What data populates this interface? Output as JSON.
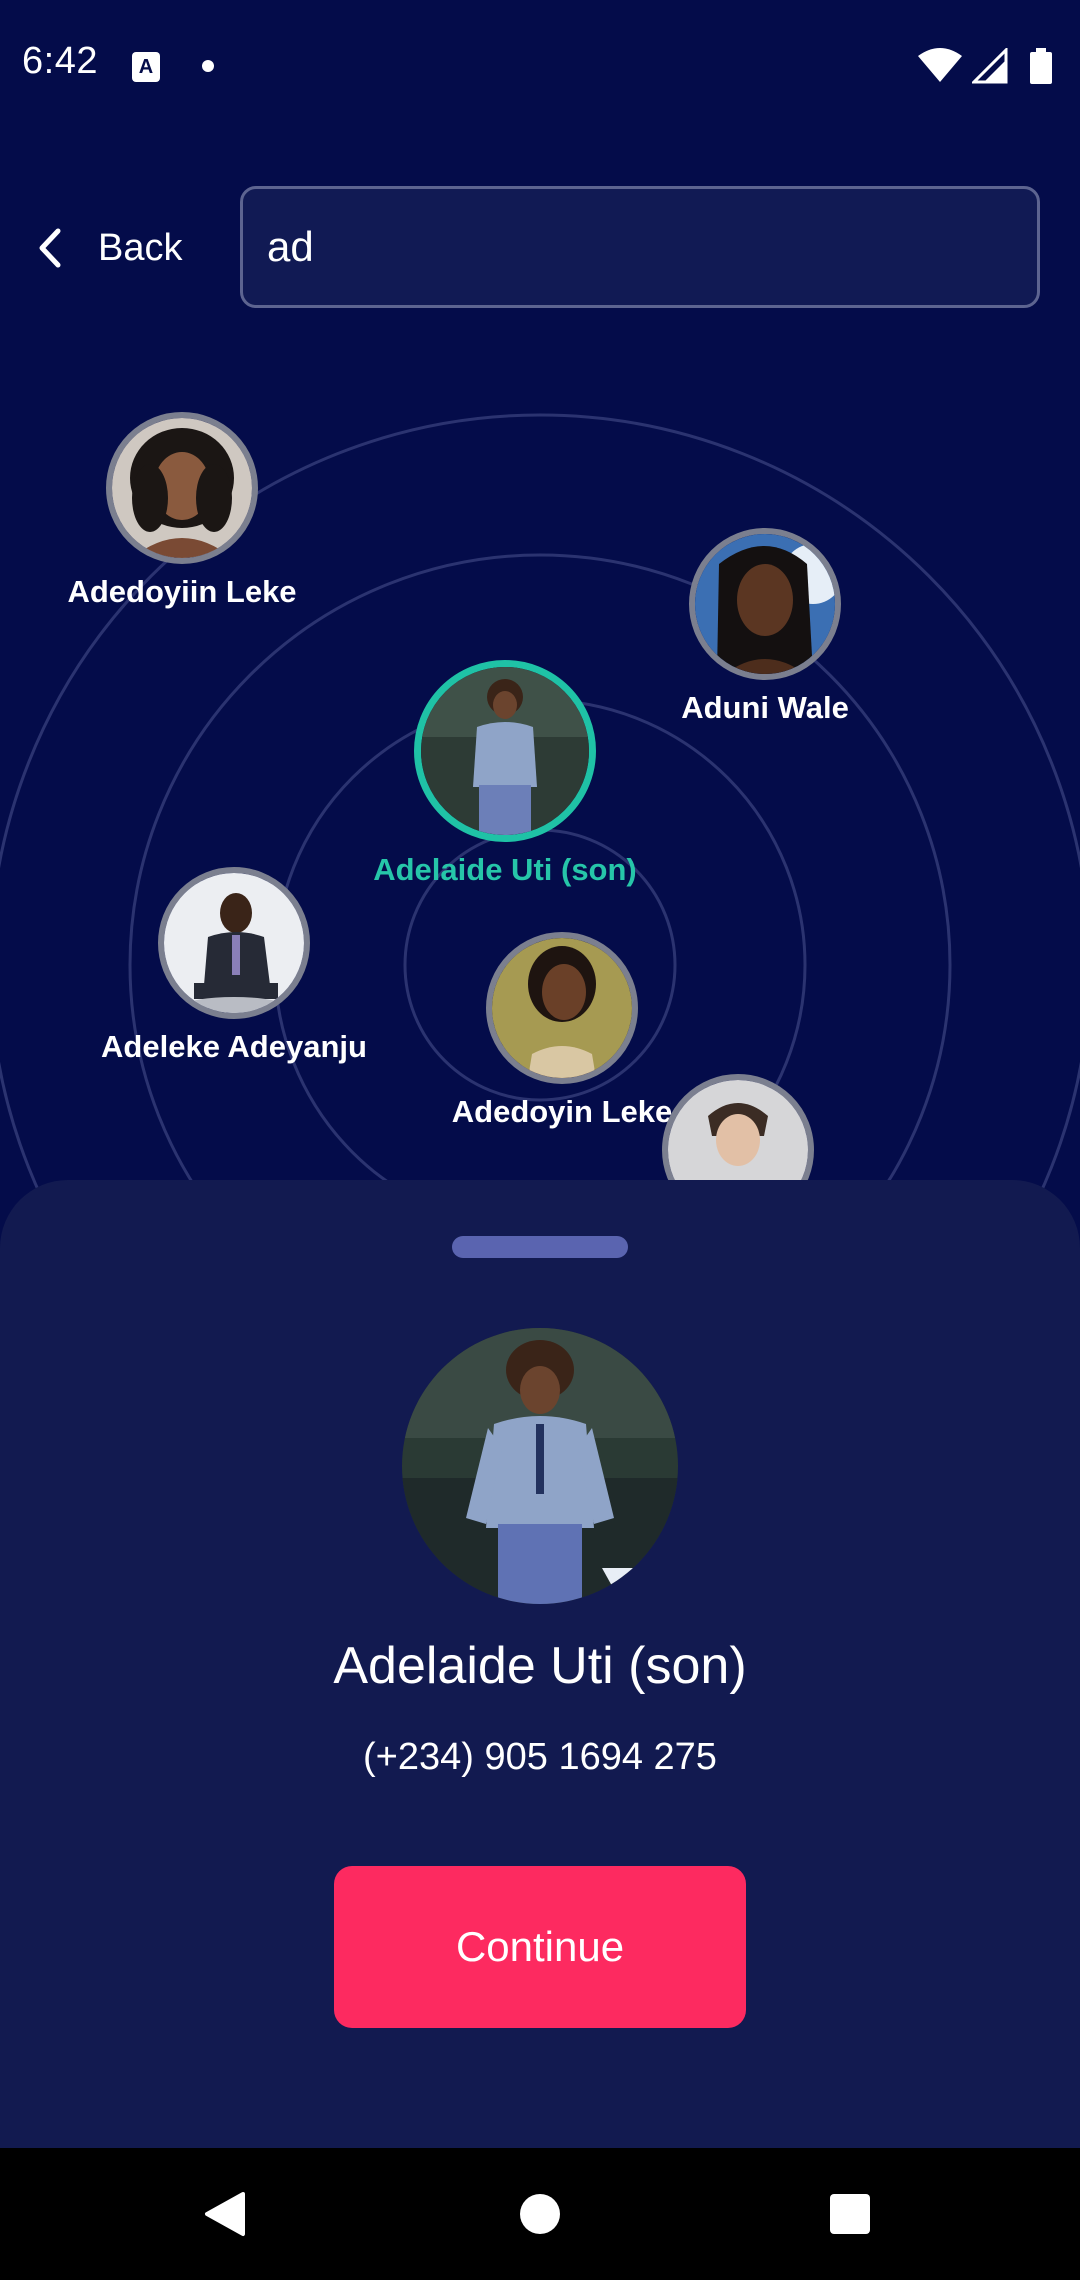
{
  "status_bar": {
    "time": "6:42",
    "notification_icon_letter": "A",
    "icons": [
      "text-notification-icon",
      "dot-icon",
      "wifi-icon",
      "signal-icon",
      "battery-icon"
    ]
  },
  "header": {
    "back_label": "Back",
    "search_value": "ad"
  },
  "contacts": [
    {
      "name": "Adedoyiin Leke",
      "selected": false,
      "avatar_bg": "#c9c2bb"
    },
    {
      "name": "Aduni Wale",
      "selected": false,
      "avatar_bg": "#3b6fb3"
    },
    {
      "name": "Adelaide Uti (son)",
      "selected": true,
      "avatar_bg": "#3e5347"
    },
    {
      "name": "Adeleke Adeyanju",
      "selected": false,
      "avatar_bg": "#e8eaee"
    },
    {
      "name": "Adedoyin Leke",
      "selected": false,
      "avatar_bg": "#a69a52"
    },
    {
      "name": "",
      "selected": false,
      "avatar_bg": "#d6d6d8"
    }
  ],
  "selected_contact": {
    "name": "Adelaide Uti (son)",
    "phone": "(+234) 905 1694 275"
  },
  "actions": {
    "continue_label": "Continue"
  },
  "colors": {
    "background": "#040c4a",
    "sheet": "#121a50",
    "accent": "#fd2a60",
    "selected_ring": "#1fc2a6"
  }
}
